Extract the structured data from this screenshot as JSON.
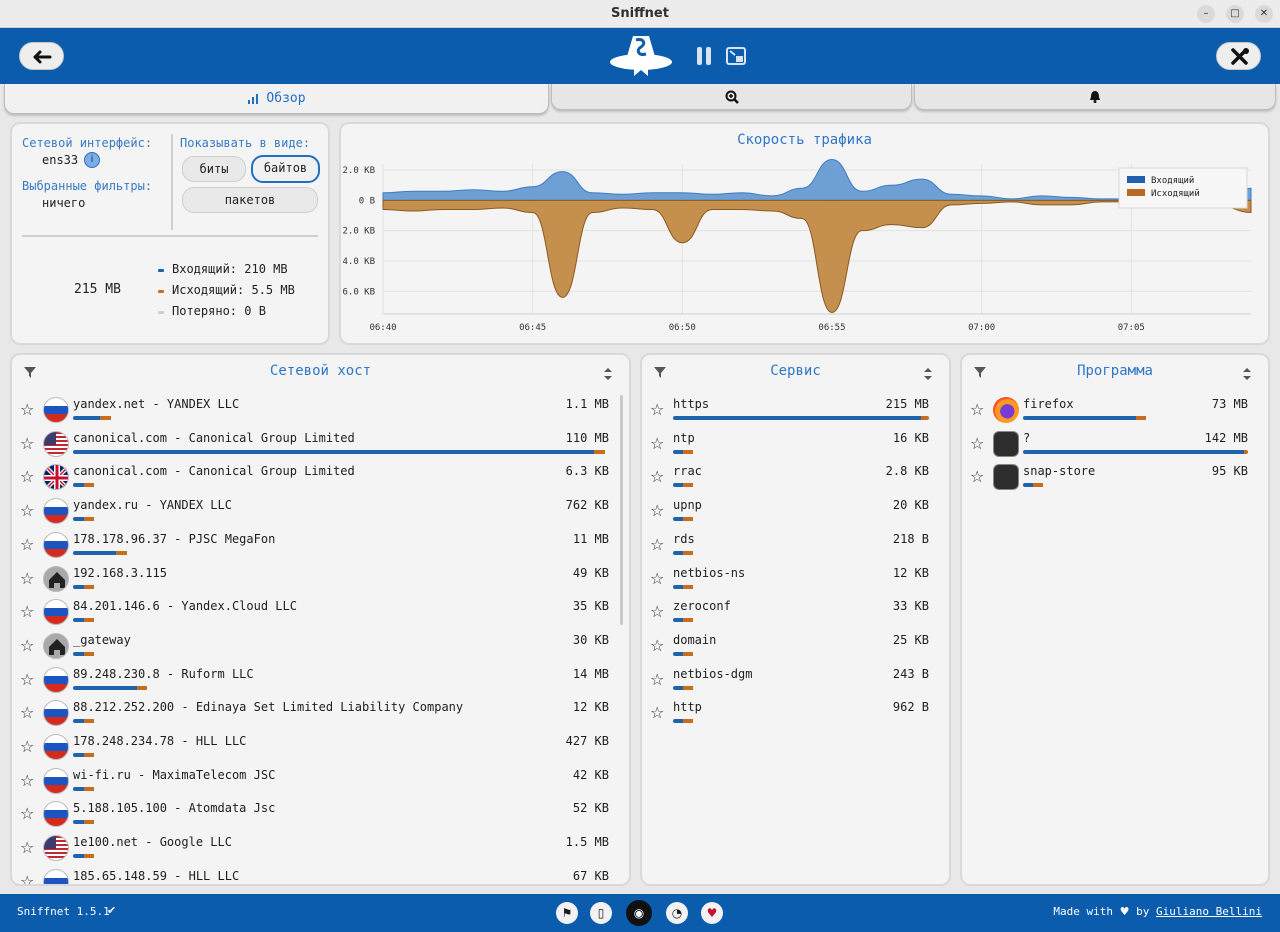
{
  "window": {
    "title": "Sniffnet"
  },
  "tabs": [
    {
      "label": "Обзор"
    },
    {
      "label": ""
    },
    {
      "label": ""
    }
  ],
  "overview": {
    "interface_label": "Сетевой интерфейс:",
    "interface_value": "ens33",
    "filters_label": "Выбранные фильтры:",
    "filters_value": "ничего",
    "show_as_label": "Показывать в виде:",
    "unit_options": [
      "биты",
      "байтов",
      "пакетов"
    ],
    "unit_selected": "байтов",
    "total": "215 MB",
    "incoming": "Входящий: 210 MB",
    "outgoing": "Исходящий: 5.5 MB",
    "dropped": "Потеряно: 0 B"
  },
  "chart_data": {
    "type": "area",
    "title": "Скорость трафика",
    "x_ticks": [
      "06:40",
      "06:45",
      "06:50",
      "06:55",
      "07:00",
      "07:05"
    ],
    "y_ticks": [
      "2.0 KB",
      "0 B",
      "2.0 KB",
      "4.0 KB",
      "6.0 KB"
    ],
    "ylim": [
      -7.5,
      2.4
    ],
    "x": [
      0,
      1,
      2,
      3,
      4,
      5,
      6,
      7,
      8,
      9,
      10,
      11,
      12,
      13,
      14,
      15,
      16,
      17,
      18,
      19,
      20,
      21,
      22,
      23,
      24,
      25,
      26,
      27,
      28,
      29
    ],
    "series": [
      {
        "name": "Входящий",
        "color": "#5f96d2",
        "values": [
          0.5,
          0.6,
          0.6,
          0.7,
          0.6,
          0.9,
          1.9,
          0.5,
          0.4,
          0.5,
          0.5,
          0.4,
          0.5,
          0.3,
          0.8,
          2.7,
          0.6,
          1.0,
          1.4,
          0.4,
          0.3,
          0.1,
          0.3,
          0.2,
          0.1,
          0.1,
          0.1,
          0.2,
          0.4,
          0.8
        ]
      },
      {
        "name": "Исходящий",
        "color": "#c0843c",
        "values": [
          -0.6,
          -0.7,
          -0.6,
          -0.6,
          -0.5,
          -0.8,
          -6.4,
          -0.8,
          -0.5,
          -0.6,
          -2.8,
          -0.6,
          -0.6,
          -0.7,
          -1.2,
          -7.4,
          -2.0,
          -1.6,
          -1.8,
          -0.3,
          -0.2,
          -0.1,
          -0.3,
          -0.3,
          -0.1,
          -0.1,
          -0.2,
          -0.3,
          -0.4,
          -0.8
        ]
      }
    ],
    "legend": "top-right",
    "grid": true
  },
  "hosts_panel": {
    "title": "Сетевой хост",
    "rows": [
      {
        "flag": "ru",
        "name": "yandex.net - YANDEX LLC",
        "value": "1.1 MB",
        "in": 0.05,
        "out": 0.02
      },
      {
        "flag": "us",
        "name": "canonical.com - Canonical Group Limited",
        "value": "110 MB",
        "in": 0.97,
        "out": 0.02
      },
      {
        "flag": "gb",
        "name": "canonical.com - Canonical Group Limited",
        "value": "6.3 KB",
        "in": 0.02,
        "out": 0.02
      },
      {
        "flag": "ru",
        "name": "yandex.ru - YANDEX LLC",
        "value": "762 KB",
        "in": 0.02,
        "out": 0.02
      },
      {
        "flag": "ru",
        "name": "178.178.96.37 - PJSC MegaFon",
        "value": "11 MB",
        "in": 0.08,
        "out": 0.02
      },
      {
        "flag": "home",
        "name": "192.168.3.115",
        "value": "49 KB",
        "in": 0.02,
        "out": 0.02
      },
      {
        "flag": "ru",
        "name": "84.201.146.6 - Yandex.Cloud LLC",
        "value": "35 KB",
        "in": 0.02,
        "out": 0.02
      },
      {
        "flag": "home",
        "name": "_gateway",
        "value": "30 KB",
        "in": 0.02,
        "out": 0.02
      },
      {
        "flag": "ru",
        "name": "89.248.230.8 - Ruform LLC",
        "value": "14 MB",
        "in": 0.12,
        "out": 0.01
      },
      {
        "flag": "ru",
        "name": "88.212.252.200 - Edinaya Set Limited Liability Company",
        "value": "12 KB",
        "in": 0.02,
        "out": 0.02
      },
      {
        "flag": "ru",
        "name": "178.248.234.78 - HLL LLC",
        "value": "427 KB",
        "in": 0.02,
        "out": 0.02
      },
      {
        "flag": "ru",
        "name": "wi-fi.ru - MaximaTelecom JSC",
        "value": "42 KB",
        "in": 0.02,
        "out": 0.02
      },
      {
        "flag": "ru",
        "name": "5.188.105.100 - Atomdata Jsc",
        "value": "52 KB",
        "in": 0.02,
        "out": 0.02
      },
      {
        "flag": "us",
        "name": "1e100.net - Google LLC",
        "value": "1.5 MB",
        "in": 0.02,
        "out": 0.02
      },
      {
        "flag": "ru",
        "name": "185.65.148.59 - HLL LLC",
        "value": "67 KB",
        "in": 0.02,
        "out": 0.02
      }
    ]
  },
  "services_panel": {
    "title": "Сервис",
    "rows": [
      {
        "name": "https",
        "value": "215 MB",
        "in": 0.97,
        "out": 0.03
      },
      {
        "name": "ntp",
        "value": "16 KB",
        "in": 0.02,
        "out": 0.02
      },
      {
        "name": "rrac",
        "value": "2.8 KB",
        "in": 0.02,
        "out": 0.02
      },
      {
        "name": "upnp",
        "value": "20 KB",
        "in": 0.02,
        "out": 0.02
      },
      {
        "name": "rds",
        "value": "218 B",
        "in": 0.02,
        "out": 0.02
      },
      {
        "name": "netbios-ns",
        "value": "12 KB",
        "in": 0.02,
        "out": 0.02
      },
      {
        "name": "zeroconf",
        "value": "33 KB",
        "in": 0.02,
        "out": 0.02
      },
      {
        "name": "domain",
        "value": "25 KB",
        "in": 0.02,
        "out": 0.02
      },
      {
        "name": "netbios-dgm",
        "value": "243 B",
        "in": 0.02,
        "out": 0.02
      },
      {
        "name": "http",
        "value": "962 B",
        "in": 0.02,
        "out": 0.02
      }
    ]
  },
  "apps_panel": {
    "title": "Программа",
    "rows": [
      {
        "icon": "firefox",
        "name": "firefox",
        "value": "73 MB",
        "in": 0.5,
        "out": 0.01
      },
      {
        "icon": "unknown",
        "name": "?",
        "value": "142 MB",
        "in": 0.98,
        "out": 0.02
      },
      {
        "icon": "snap",
        "name": "snap-store",
        "value": "95 KB",
        "in": 0.02,
        "out": 0.02
      }
    ]
  },
  "footer": {
    "version": "Sniffnet 1.5.1",
    "made_with_prefix": "Made with",
    "made_with_by": "by",
    "author": "Giuliano Bellini"
  },
  "colors": {
    "brand": "#0b5cad",
    "incoming": "#1f63ad",
    "outgoing": "#c66d1f",
    "accent": "#2f77c6"
  }
}
